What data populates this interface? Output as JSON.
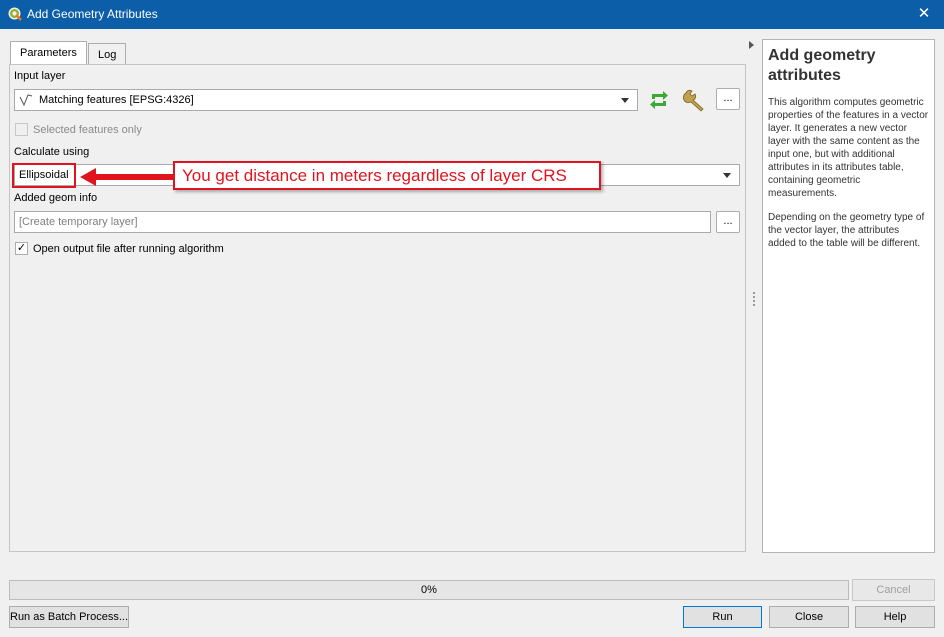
{
  "window": {
    "title": "Add Geometry Attributes",
    "close_glyph": "✕"
  },
  "tabs": [
    {
      "label": "Parameters",
      "active": true
    },
    {
      "label": "Log",
      "active": false
    }
  ],
  "params": {
    "input_layer_label": "Input layer",
    "input_layer_value": "Matching features [EPSG:4326]",
    "input_layer_icon": "line-layer-icon",
    "ellipsis": "...",
    "selected_only_label": "Selected features only",
    "calc_label": "Calculate using",
    "calc_value": "Ellipsoidal",
    "added_geom_label": "Added geom info",
    "added_geom_placeholder": "[Create temporary layer]",
    "open_output_label": "Open output file after running algorithm"
  },
  "annotation": {
    "text": "You get distance in meters regardless of layer CRS",
    "color": "#e0141e"
  },
  "help": {
    "title": "Add geometry attributes",
    "p1": "This algorithm computes geometric properties of the features in a vector layer. It generates a new vector layer with the same content as the input one, but with additional attributes in its attributes table, containing geometric measurements.",
    "p2": "Depending on the geometry type of the vector layer, the attributes added to the table will be different."
  },
  "progress": {
    "label": "0%",
    "value": 0
  },
  "buttons": {
    "cancel": "Cancel",
    "batch": "Run as Batch Process...",
    "run": "Run",
    "close": "Close",
    "help": "Help"
  },
  "colors": {
    "titlebar": "#0d5ea8",
    "annotation": "#e0141e",
    "refresh_icon": "#3aa935"
  }
}
